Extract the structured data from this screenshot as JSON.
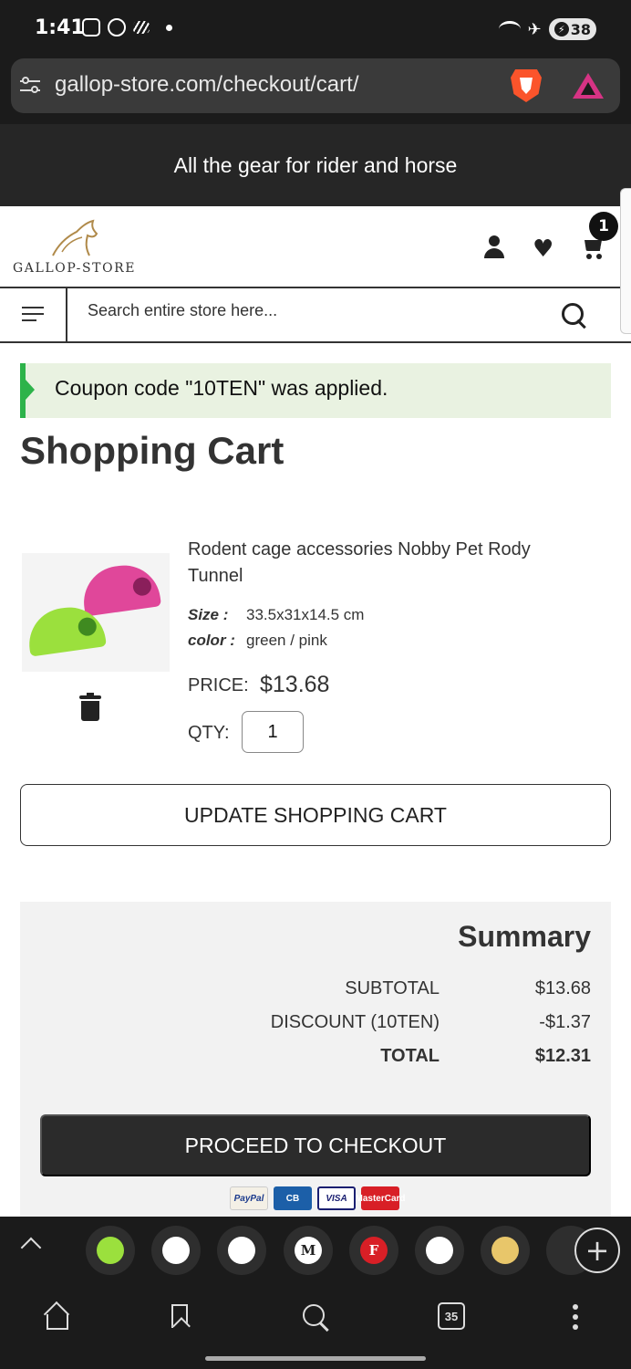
{
  "status_bar": {
    "time": "1:41",
    "battery": "38"
  },
  "browser": {
    "url": "gallop-store.com/checkout/cart/",
    "tab_count": "35"
  },
  "banner": {
    "text": "All the gear for rider and horse"
  },
  "header": {
    "logo_text": "GALLOP-STORE",
    "cart_count": "1"
  },
  "search": {
    "placeholder": "Search entire store here..."
  },
  "message": {
    "text": "Coupon code \"10TEN\" was applied."
  },
  "page": {
    "title": "Shopping Cart"
  },
  "cart_item": {
    "name": "Rodent cage accessories Nobby Pet Rody Tunnel",
    "options": [
      {
        "label": "Size :",
        "value": "33.5x31x14.5 cm"
      },
      {
        "label": "color :",
        "value": "green / pink"
      }
    ],
    "price_label": "PRICE:",
    "price": "$13.68",
    "qty_label": "QTY:",
    "qty": "1"
  },
  "update_button": "UPDATE SHOPPING CART",
  "summary": {
    "title": "Summary",
    "rows": [
      {
        "label": "SUBTOTAL",
        "value": "$13.68"
      },
      {
        "label": "DISCOUNT (10TEN)",
        "value": "-$1.37"
      },
      {
        "label": "TOTAL",
        "value": "$12.31"
      }
    ],
    "checkout_button": "PROCEED TO CHECKOUT",
    "payment_methods": [
      "PayPal",
      "CB",
      "VISA",
      "MasterCard"
    ]
  },
  "tabs_strip": [
    "",
    "",
    "",
    "M",
    "F",
    "",
    ""
  ],
  "colors": {
    "success": "#2db34a",
    "message_bg": "#e9f2e1",
    "checkout_bg": "#2b2b2b",
    "banner_bg": "#262626"
  }
}
